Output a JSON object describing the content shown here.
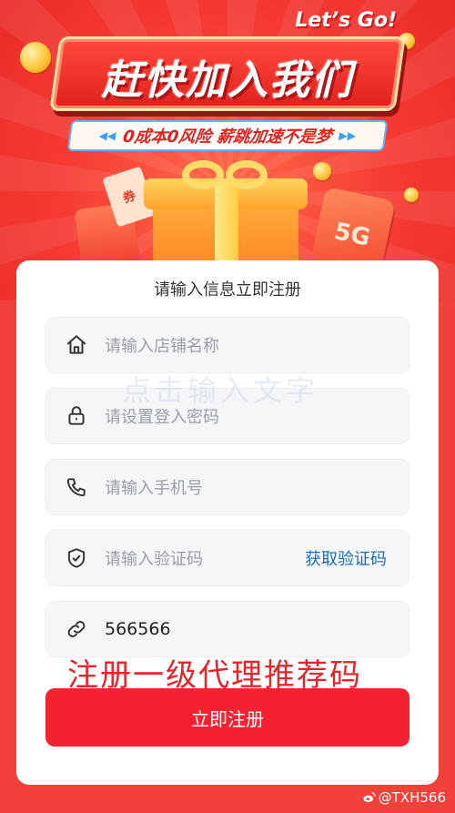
{
  "banner": {
    "tagline_en": "Let’s Go!",
    "title": "赶快加入我们",
    "slogan": "0成本0风险  薪跳加速不是梦",
    "badge_5g": "5G",
    "ticket_text": "券"
  },
  "form": {
    "heading": "请输入信息立即注册",
    "fields": [
      {
        "placeholder": "请输入店铺名称",
        "icon": "home-icon"
      },
      {
        "placeholder": "请设置登入密码",
        "icon": "lock-icon"
      },
      {
        "placeholder": "请输入手机号",
        "icon": "phone-icon"
      },
      {
        "placeholder": "请输入验证码",
        "icon": "shield-check-icon",
        "action": "获取验证码"
      },
      {
        "value": "566566",
        "icon": "link-icon"
      }
    ],
    "submit_label": "立即注册"
  },
  "overlays": {
    "watermark": "点击输入文字",
    "promo": "注册一级代理推荐码"
  },
  "credit": "@TXH566",
  "colors": {
    "accent_red": "#f42230",
    "link_blue": "#1a6fb8",
    "background_red": "#f2413a"
  }
}
